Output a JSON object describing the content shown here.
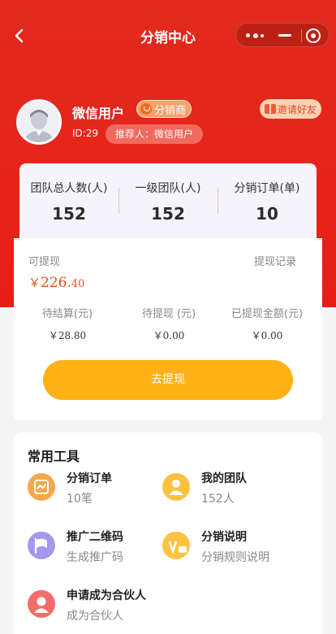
{
  "nav": {
    "title": "分销中心"
  },
  "user": {
    "name": "微信用户",
    "role_badge": "分销商",
    "id_text": "ID:29",
    "referrer": "推荐人：微信用户",
    "invite_label": "邀请好友"
  },
  "stats": [
    {
      "label": "团队总人数(人)",
      "value": "152"
    },
    {
      "label": "一级团队(人)",
      "value": "152"
    },
    {
      "label": "分销订单(单)",
      "value": "10"
    }
  ],
  "wallet": {
    "withdrawable_label": "可提现",
    "records_link": "提现记录",
    "amount_currency": "￥",
    "amount_int": "226.",
    "amount_dec": "40",
    "sub": [
      {
        "label": "待结算(元)",
        "value": "￥28.80"
      },
      {
        "label": "待提现 (元)",
        "value": "￥0.00"
      },
      {
        "label": "已提现金额(元)",
        "value": "￥0.00"
      }
    ],
    "withdraw_button": "去提现"
  },
  "tools": {
    "title": "常用工具",
    "items": [
      {
        "title": "分销订单",
        "subtitle": "10笔",
        "icon": "order-icon",
        "color": "#f7a84a"
      },
      {
        "title": "我的团队",
        "subtitle": "152人",
        "icon": "team-icon",
        "color": "#fbc23e"
      },
      {
        "title": "推广二维码",
        "subtitle": "生成推广码",
        "icon": "flag-icon",
        "color": "#a796f0"
      },
      {
        "title": "分销说明",
        "subtitle": "分销规则说明",
        "icon": "vip-icon",
        "color": "#fcc342"
      },
      {
        "title": "申请成为合伙人",
        "subtitle": "成为合伙人",
        "icon": "partner-icon",
        "color": "#f56b6b"
      }
    ]
  },
  "colors": {
    "brand_red": "#e8241a",
    "accent_orange": "#feb215",
    "amount_color": "#e8521d"
  }
}
